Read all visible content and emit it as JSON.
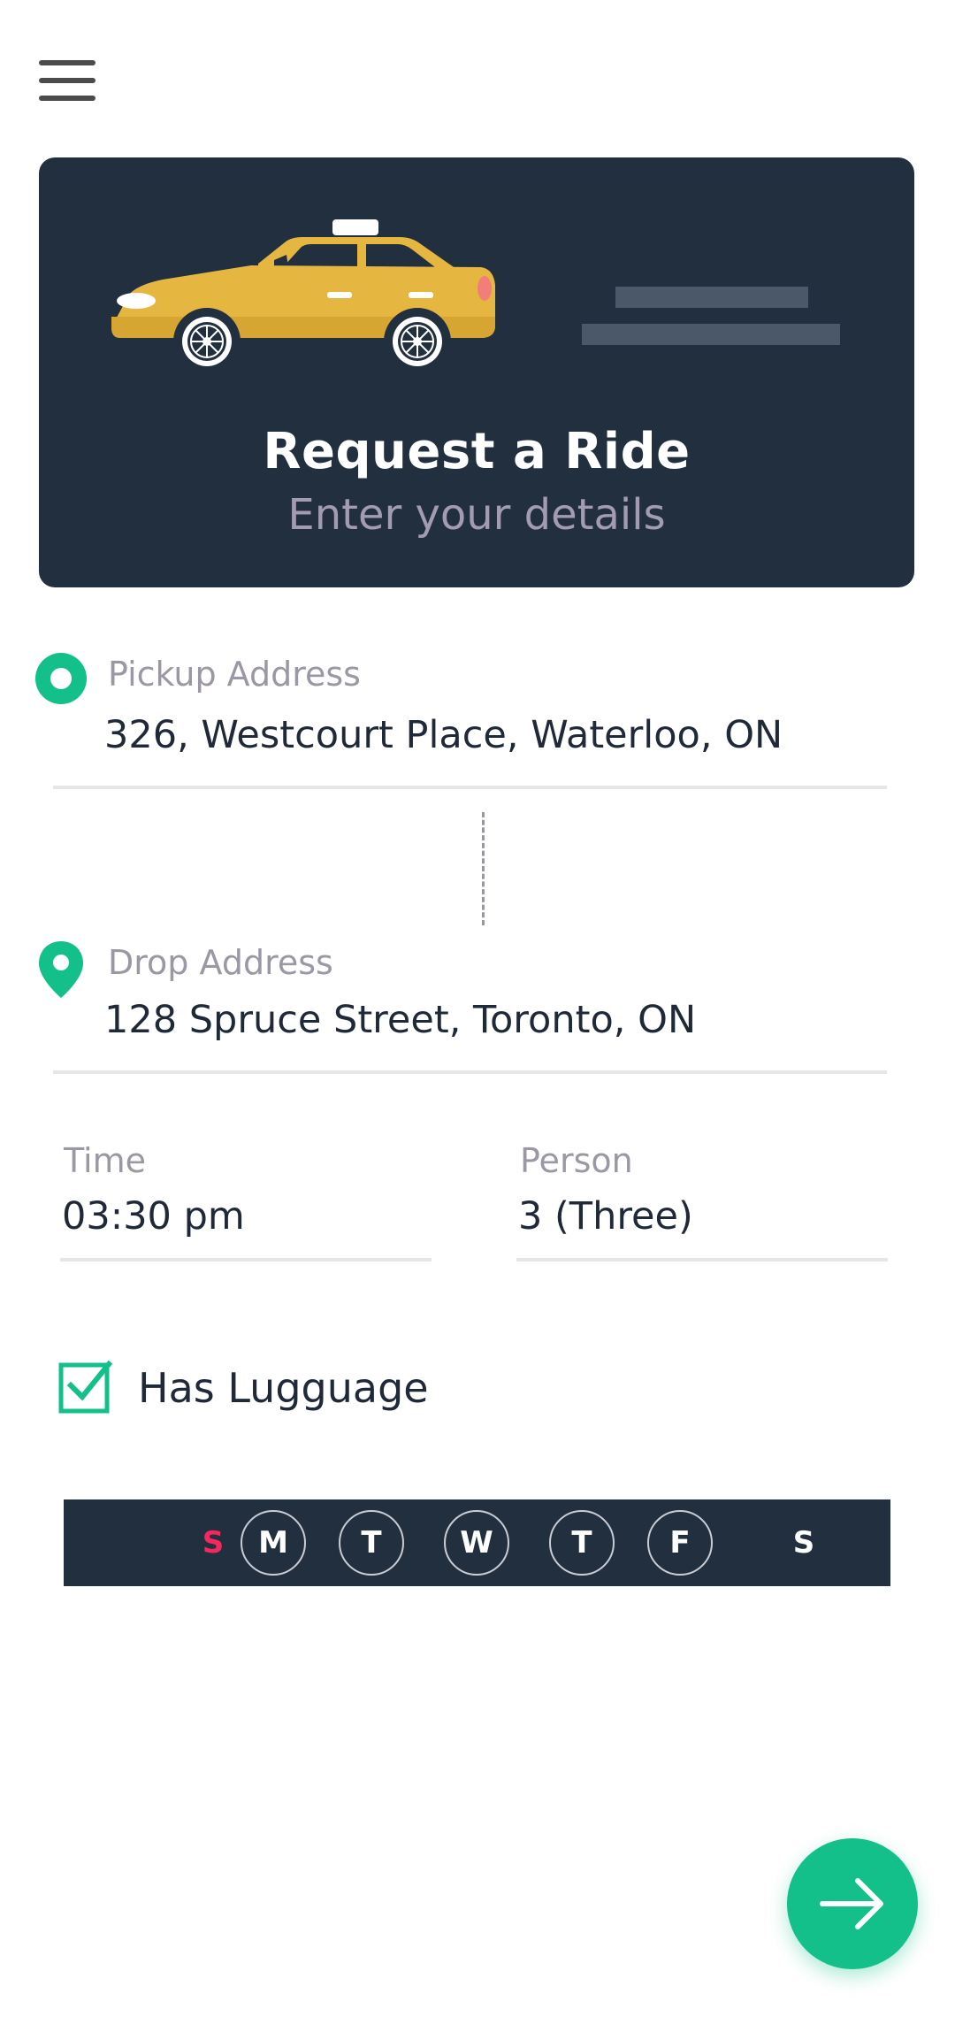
{
  "header": {
    "menu_icon": "hamburger-menu-icon"
  },
  "hero": {
    "title": "Request a Ride",
    "subtitle": "Enter your details",
    "illustration": "taxi-car-icon",
    "background_color": "#222f3e",
    "car_color": "#e5b740"
  },
  "pickup": {
    "label": "Pickup Address",
    "value": "326, Westcourt Place, Waterloo, ON",
    "icon": "pickup-dot-icon"
  },
  "drop": {
    "label": "Drop Address",
    "value": "128 Spruce Street, Toronto, ON",
    "icon": "location-pin-icon"
  },
  "time": {
    "label": "Time",
    "value": "03:30 pm"
  },
  "person": {
    "label": "Person",
    "value": "3 (Three)"
  },
  "luggage": {
    "label": "Has Lugguage",
    "checked": true
  },
  "days": [
    {
      "label": "S",
      "highlight": "red",
      "circled": false
    },
    {
      "label": "M",
      "circled": true
    },
    {
      "label": "T",
      "circled": true
    },
    {
      "label": "W",
      "circled": true
    },
    {
      "label": "T",
      "circled": true
    },
    {
      "label": "F",
      "circled": true
    },
    {
      "label": "S",
      "circled": false
    }
  ],
  "next_button": {
    "icon": "arrow-right-icon"
  },
  "colors": {
    "accent": "#13c08a",
    "dark": "#222f3e",
    "weekend_red": "#f2285f",
    "muted_label": "#9b98a3"
  }
}
